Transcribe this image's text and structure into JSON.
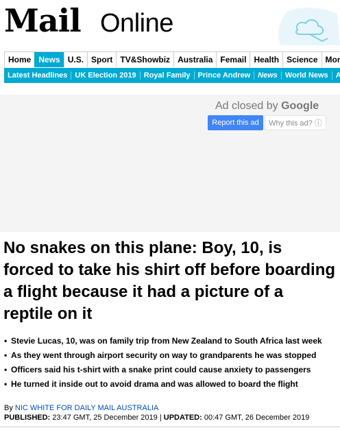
{
  "logo": {
    "mail": "Mail",
    "online": "Online"
  },
  "nav_primary": [
    {
      "label": "Home"
    },
    {
      "label": "News"
    },
    {
      "label": "U.S."
    },
    {
      "label": "Sport"
    },
    {
      "label": "TV&Showbiz"
    },
    {
      "label": "Australia"
    },
    {
      "label": "Femail"
    },
    {
      "label": "Health"
    },
    {
      "label": "Science"
    },
    {
      "label": "Mon"
    }
  ],
  "nav_primary_active": "News",
  "nav_secondary": [
    {
      "label": "Latest Headlines"
    },
    {
      "label": "UK Election 2019"
    },
    {
      "label": "Royal Family"
    },
    {
      "label": "Prince Andrew"
    },
    {
      "label": "News"
    },
    {
      "label": "World News"
    },
    {
      "label": "Arts"
    }
  ],
  "ad": {
    "closed_prefix": "Ad closed by ",
    "closed_brand": "Google",
    "report_label": "Report this ad",
    "why_label": "Why this ad? ⓘ"
  },
  "article": {
    "headline": "No snakes on this plane: Boy, 10, is forced to take his shirt off before boarding a flight because it had a picture of a reptile on it",
    "bullets": [
      "Stevie Lucas, 10, was on family trip from New Zealand to South Africa last week",
      "As they went through airport security on way to grandparents he was stopped",
      "Officers said his t-shirt with a snake print could cause anxiety to passengers",
      "He turned it inside out to avoid drama and was allowed to board the flight"
    ],
    "byline_prefix": "By ",
    "author": "NIC WHITE FOR DAILY MAIL AUSTRALIA",
    "published_label": "PUBLISHED:",
    "published_value": "23:47 GMT, 25 December 2019",
    "separator": "|",
    "updated_label": "UPDATED:",
    "updated_value": "00:47 GMT, 26 December 2019"
  },
  "colors": {
    "accent": "#00aad2",
    "link": "#004db3",
    "ad_button": "#4285f4"
  },
  "icons": {
    "weather": "weather-cloud-icon"
  }
}
